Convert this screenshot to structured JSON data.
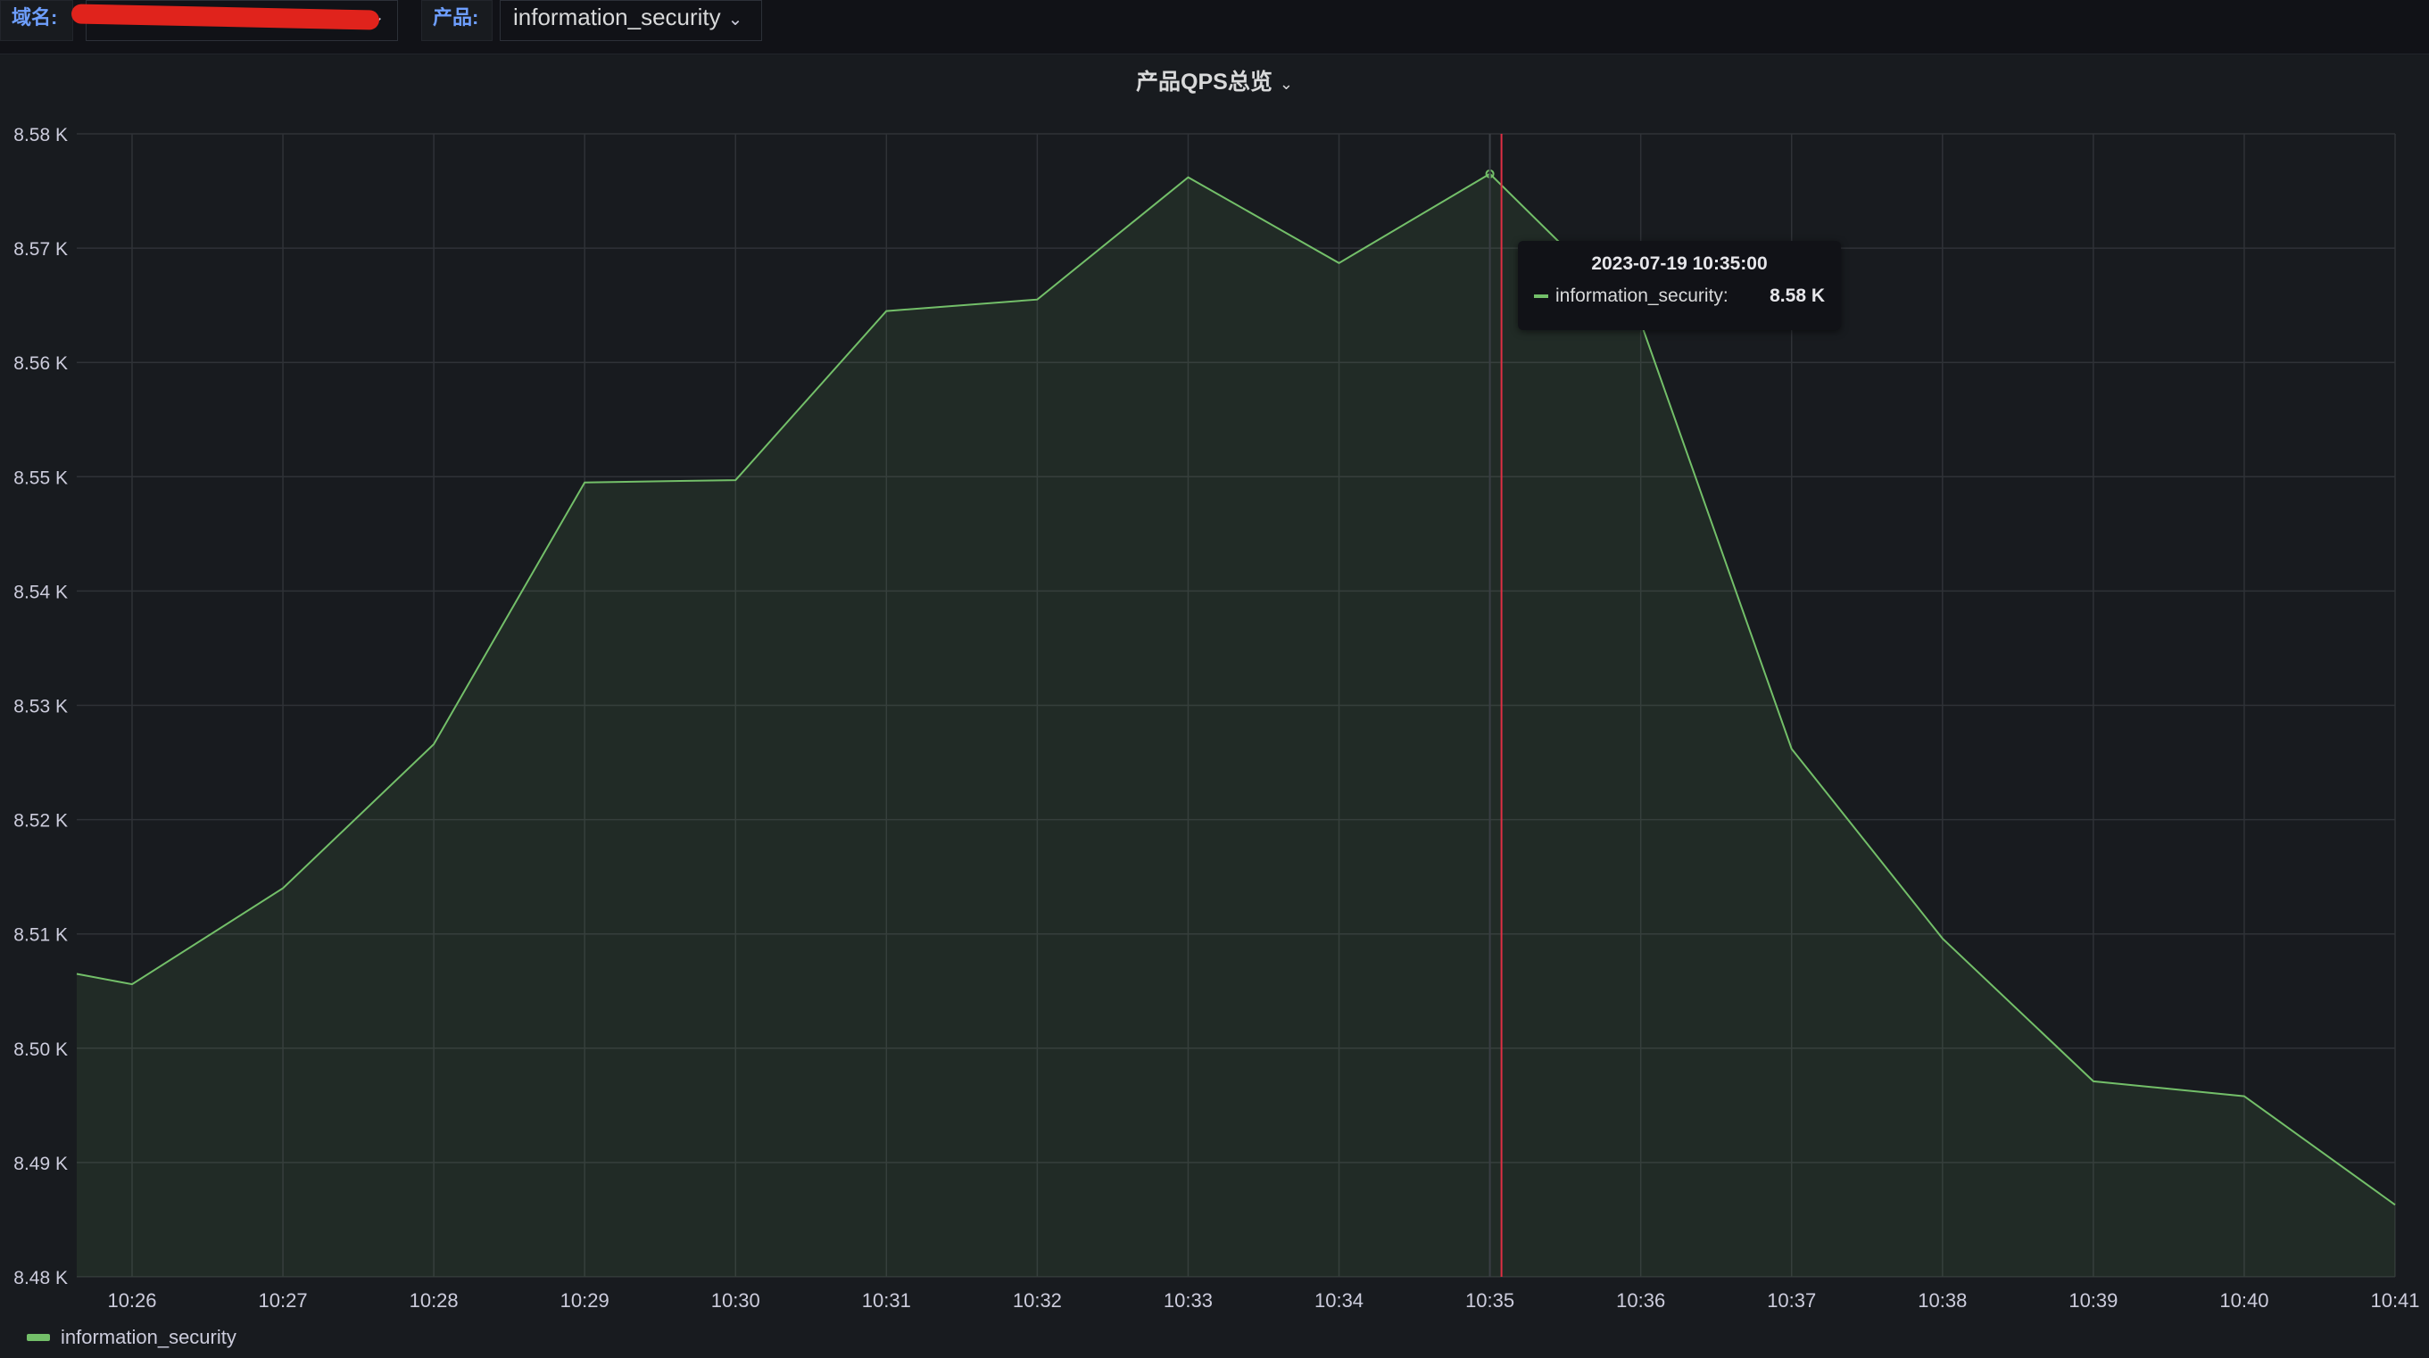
{
  "variables": {
    "domain_label": "域名:",
    "domain_value": "",
    "product_label": "产品:",
    "product_value": "information_security"
  },
  "panel": {
    "title": "产品QPS总览"
  },
  "tooltip": {
    "time": "2023-07-19 10:35:00",
    "series": "information_security:",
    "value": "8.58 K"
  },
  "legend": {
    "series_name": "information_security"
  },
  "colors": {
    "series": "#73bf69",
    "cursor": "#e02f44",
    "grid": "#2f3237",
    "background": "#181b1f"
  },
  "chart_data": {
    "type": "area",
    "title": "产品QPS总览",
    "xlabel": "",
    "ylabel": "",
    "x_ticks": [
      "10:26",
      "10:27",
      "10:28",
      "10:29",
      "10:30",
      "10:31",
      "10:32",
      "10:33",
      "10:34",
      "10:35",
      "10:36",
      "10:37",
      "10:38",
      "10:39",
      "10:40",
      "10:41"
    ],
    "y_ticks": [
      "8.48 K",
      "8.49 K",
      "8.50 K",
      "8.51 K",
      "8.52 K",
      "8.53 K",
      "8.54 K",
      "8.55 K",
      "8.56 K",
      "8.57 K",
      "8.58 K"
    ],
    "ylim": [
      8480,
      8580
    ],
    "xlim": [
      "10:25:38",
      "10:41:00"
    ],
    "grid": true,
    "legend_position": "bottom-left",
    "series": [
      {
        "name": "information_security",
        "x": [
          "10:25:38",
          "10:26",
          "10:27",
          "10:28",
          "10:29",
          "10:30",
          "10:31",
          "10:32",
          "10:33",
          "10:34",
          "10:35",
          "10:36",
          "10:37",
          "10:38",
          "10:39",
          "10:40",
          "10:41"
        ],
        "values": [
          8506.5,
          8505.6,
          8514.0,
          8526.6,
          8549.5,
          8549.7,
          8564.5,
          8565.5,
          8576.2,
          8568.7,
          8576.5,
          8563.5,
          8526.2,
          8509.6,
          8497.1,
          8495.8,
          8486.3
        ]
      }
    ],
    "cursor_time": "10:35"
  }
}
